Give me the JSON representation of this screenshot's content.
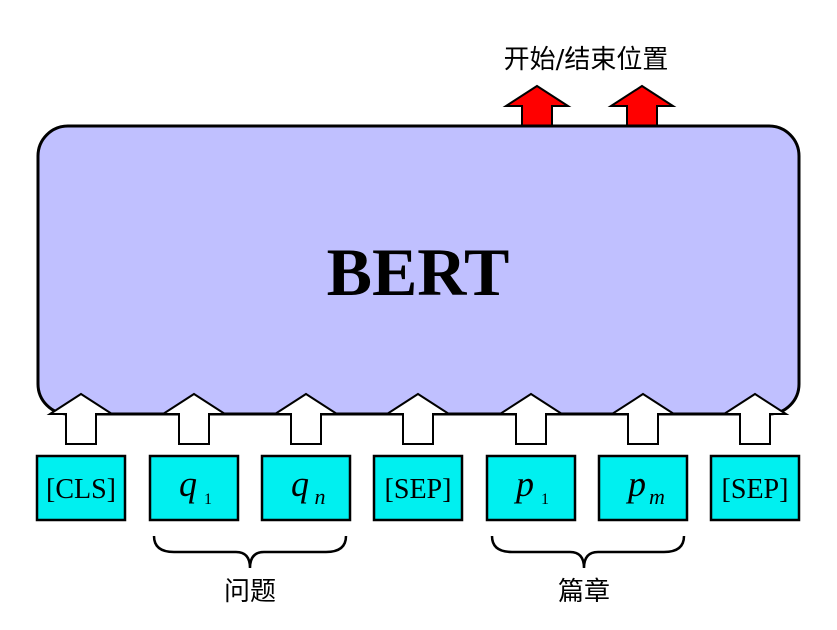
{
  "output_label": "开始/结束位置",
  "model_label": "BERT",
  "tokens": [
    {
      "kind": "text",
      "label": "[CLS]"
    },
    {
      "kind": "math",
      "base": "q",
      "sub": "1"
    },
    {
      "kind": "math",
      "base": "q",
      "sub": "n"
    },
    {
      "kind": "text",
      "label": "[SEP]"
    },
    {
      "kind": "math",
      "base": "p",
      "sub": "1"
    },
    {
      "kind": "math",
      "base": "p",
      "sub": "m"
    },
    {
      "kind": "text",
      "label": "[SEP]"
    }
  ],
  "group_labels": {
    "question": "问题",
    "passage": "篇章"
  },
  "colors": {
    "model_fill": "#c0c0ff",
    "token_fill": "#00f0f0",
    "output_arrow": "#ff0000",
    "input_arrow": "#ffffff",
    "stroke": "#000000"
  }
}
